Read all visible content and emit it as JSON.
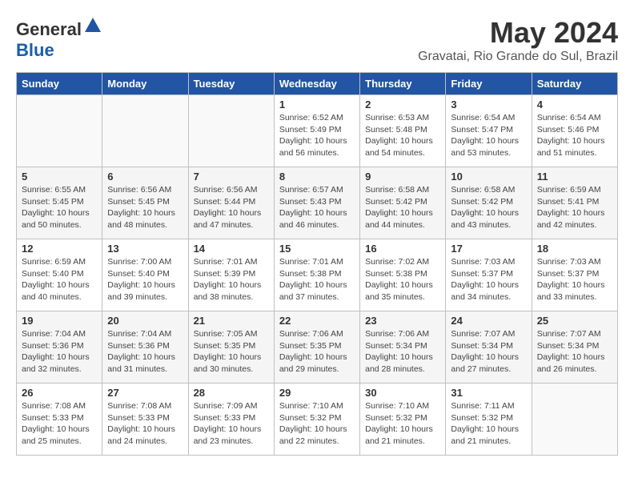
{
  "header": {
    "logo_general": "General",
    "logo_blue": "Blue",
    "month_year": "May 2024",
    "location": "Gravatai, Rio Grande do Sul, Brazil"
  },
  "weekdays": [
    "Sunday",
    "Monday",
    "Tuesday",
    "Wednesday",
    "Thursday",
    "Friday",
    "Saturday"
  ],
  "weeks": [
    [
      {
        "day": "",
        "info": ""
      },
      {
        "day": "",
        "info": ""
      },
      {
        "day": "",
        "info": ""
      },
      {
        "day": "1",
        "info": "Sunrise: 6:52 AM\nSunset: 5:49 PM\nDaylight: 10 hours\nand 56 minutes."
      },
      {
        "day": "2",
        "info": "Sunrise: 6:53 AM\nSunset: 5:48 PM\nDaylight: 10 hours\nand 54 minutes."
      },
      {
        "day": "3",
        "info": "Sunrise: 6:54 AM\nSunset: 5:47 PM\nDaylight: 10 hours\nand 53 minutes."
      },
      {
        "day": "4",
        "info": "Sunrise: 6:54 AM\nSunset: 5:46 PM\nDaylight: 10 hours\nand 51 minutes."
      }
    ],
    [
      {
        "day": "5",
        "info": "Sunrise: 6:55 AM\nSunset: 5:45 PM\nDaylight: 10 hours\nand 50 minutes."
      },
      {
        "day": "6",
        "info": "Sunrise: 6:56 AM\nSunset: 5:45 PM\nDaylight: 10 hours\nand 48 minutes."
      },
      {
        "day": "7",
        "info": "Sunrise: 6:56 AM\nSunset: 5:44 PM\nDaylight: 10 hours\nand 47 minutes."
      },
      {
        "day": "8",
        "info": "Sunrise: 6:57 AM\nSunset: 5:43 PM\nDaylight: 10 hours\nand 46 minutes."
      },
      {
        "day": "9",
        "info": "Sunrise: 6:58 AM\nSunset: 5:42 PM\nDaylight: 10 hours\nand 44 minutes."
      },
      {
        "day": "10",
        "info": "Sunrise: 6:58 AM\nSunset: 5:42 PM\nDaylight: 10 hours\nand 43 minutes."
      },
      {
        "day": "11",
        "info": "Sunrise: 6:59 AM\nSunset: 5:41 PM\nDaylight: 10 hours\nand 42 minutes."
      }
    ],
    [
      {
        "day": "12",
        "info": "Sunrise: 6:59 AM\nSunset: 5:40 PM\nDaylight: 10 hours\nand 40 minutes."
      },
      {
        "day": "13",
        "info": "Sunrise: 7:00 AM\nSunset: 5:40 PM\nDaylight: 10 hours\nand 39 minutes."
      },
      {
        "day": "14",
        "info": "Sunrise: 7:01 AM\nSunset: 5:39 PM\nDaylight: 10 hours\nand 38 minutes."
      },
      {
        "day": "15",
        "info": "Sunrise: 7:01 AM\nSunset: 5:38 PM\nDaylight: 10 hours\nand 37 minutes."
      },
      {
        "day": "16",
        "info": "Sunrise: 7:02 AM\nSunset: 5:38 PM\nDaylight: 10 hours\nand 35 minutes."
      },
      {
        "day": "17",
        "info": "Sunrise: 7:03 AM\nSunset: 5:37 PM\nDaylight: 10 hours\nand 34 minutes."
      },
      {
        "day": "18",
        "info": "Sunrise: 7:03 AM\nSunset: 5:37 PM\nDaylight: 10 hours\nand 33 minutes."
      }
    ],
    [
      {
        "day": "19",
        "info": "Sunrise: 7:04 AM\nSunset: 5:36 PM\nDaylight: 10 hours\nand 32 minutes."
      },
      {
        "day": "20",
        "info": "Sunrise: 7:04 AM\nSunset: 5:36 PM\nDaylight: 10 hours\nand 31 minutes."
      },
      {
        "day": "21",
        "info": "Sunrise: 7:05 AM\nSunset: 5:35 PM\nDaylight: 10 hours\nand 30 minutes."
      },
      {
        "day": "22",
        "info": "Sunrise: 7:06 AM\nSunset: 5:35 PM\nDaylight: 10 hours\nand 29 minutes."
      },
      {
        "day": "23",
        "info": "Sunrise: 7:06 AM\nSunset: 5:34 PM\nDaylight: 10 hours\nand 28 minutes."
      },
      {
        "day": "24",
        "info": "Sunrise: 7:07 AM\nSunset: 5:34 PM\nDaylight: 10 hours\nand 27 minutes."
      },
      {
        "day": "25",
        "info": "Sunrise: 7:07 AM\nSunset: 5:34 PM\nDaylight: 10 hours\nand 26 minutes."
      }
    ],
    [
      {
        "day": "26",
        "info": "Sunrise: 7:08 AM\nSunset: 5:33 PM\nDaylight: 10 hours\nand 25 minutes."
      },
      {
        "day": "27",
        "info": "Sunrise: 7:08 AM\nSunset: 5:33 PM\nDaylight: 10 hours\nand 24 minutes."
      },
      {
        "day": "28",
        "info": "Sunrise: 7:09 AM\nSunset: 5:33 PM\nDaylight: 10 hours\nand 23 minutes."
      },
      {
        "day": "29",
        "info": "Sunrise: 7:10 AM\nSunset: 5:32 PM\nDaylight: 10 hours\nand 22 minutes."
      },
      {
        "day": "30",
        "info": "Sunrise: 7:10 AM\nSunset: 5:32 PM\nDaylight: 10 hours\nand 21 minutes."
      },
      {
        "day": "31",
        "info": "Sunrise: 7:11 AM\nSunset: 5:32 PM\nDaylight: 10 hours\nand 21 minutes."
      },
      {
        "day": "",
        "info": ""
      }
    ]
  ]
}
